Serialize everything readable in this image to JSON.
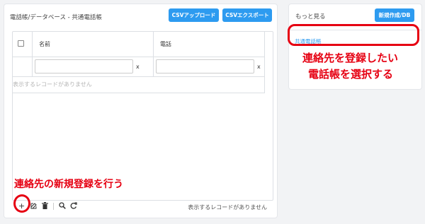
{
  "main": {
    "title": "電話帳/データベース - 共通電話帳",
    "csv_upload_label": "CSVアップロード",
    "csv_export_label": "CSVエクスポート",
    "columns": [
      "名前",
      "電話"
    ],
    "clear_filter_label": "x",
    "empty_message": "表示するレコードがありません",
    "footer_message": "表示するレコードがありません",
    "toolbar_icons": [
      "plus-icon",
      "edit-icon",
      "trash-icon",
      "search-icon",
      "refresh-icon"
    ]
  },
  "side": {
    "title": "もっと見る",
    "new_button_label": "新規作成/DB",
    "phonebook_link": "共通電話帳"
  },
  "annotations": {
    "select_phonebook_line1": "連絡先を登録したい",
    "select_phonebook_line2": "電話帳を選択する",
    "new_contact": "連絡先の新規登録を行う"
  },
  "colors": {
    "accent": "#2d9bf0",
    "annotation": "#e60012",
    "background": "#f2f3f5"
  }
}
